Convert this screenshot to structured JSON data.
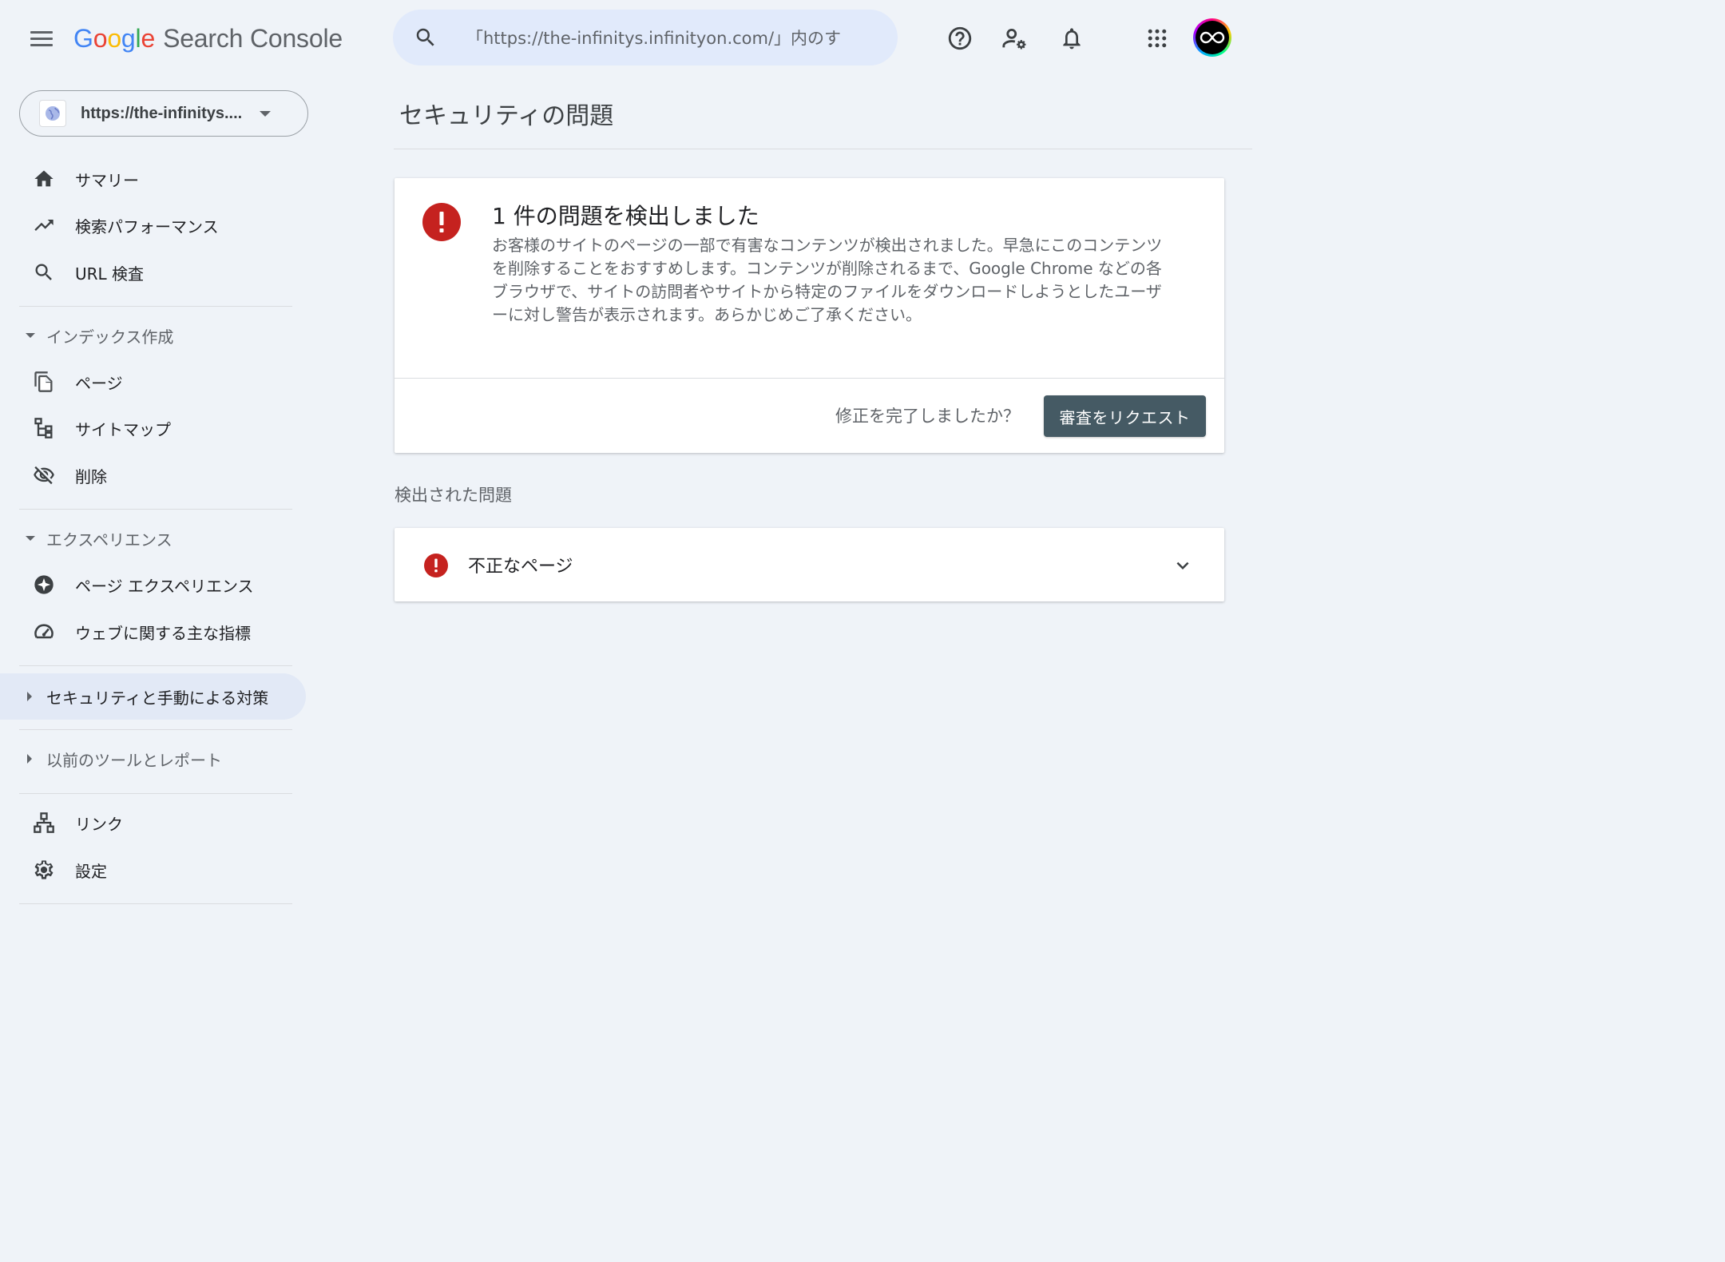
{
  "header": {
    "logo_letters": [
      "G",
      "o",
      "o",
      "g",
      "l",
      "e"
    ],
    "logo_colors": [
      "#4285F4",
      "#EA4335",
      "#FBBC05",
      "#4285F4",
      "#34A853",
      "#EA4335"
    ],
    "product": "Search Console",
    "search_placeholder": "「https://the-infinitys.infinityon.com/」内のす",
    "icons": [
      "menu-icon",
      "search-icon",
      "help-icon",
      "manage-users-icon",
      "bell-icon",
      "apps-grid-icon",
      "avatar"
    ]
  },
  "sidebar": {
    "property": "https://the-infinitys....",
    "items": {
      "summary": "サマリー",
      "performance": "検索パフォーマンス",
      "url_inspection": "URL 検査",
      "pages": "ページ",
      "sitemaps": "サイトマップ",
      "removals": "削除",
      "page_experience": "ページ エクスペリエンス",
      "core_web_vitals": "ウェブに関する主な指標",
      "links": "リンク",
      "settings": "設定"
    },
    "sections": {
      "indexing": "インデックス作成",
      "experience": "エクスペリエンス",
      "security": "セキュリティと手動による対策",
      "legacy": "以前のツールとレポート"
    }
  },
  "main": {
    "title": "セキュリティの問題",
    "card": {
      "heading": "1 件の問題を検出しました",
      "description": "お客様のサイトのページの一部で有害なコンテンツが検出されました。早急にこのコンテンツを削除することをおすすめします。コンテンツが削除されるまで、Google Chrome などの各ブラウザで、サイトの訪問者やサイトから特定のファイルをダウンロードしようとしたユーザーに対し警告が表示されます。あらかじめご了承ください。",
      "question": "修正を完了しましたか？",
      "button": "審査をリクエスト"
    },
    "detected_heading": "検出された問題",
    "issues": [
      {
        "label": "不正なページ",
        "severity": "error"
      }
    ]
  },
  "colors": {
    "background": "#eff3f8",
    "error_red": "#c5221f",
    "button_bg": "#455a64",
    "active_nav": "#e2e9f6"
  }
}
